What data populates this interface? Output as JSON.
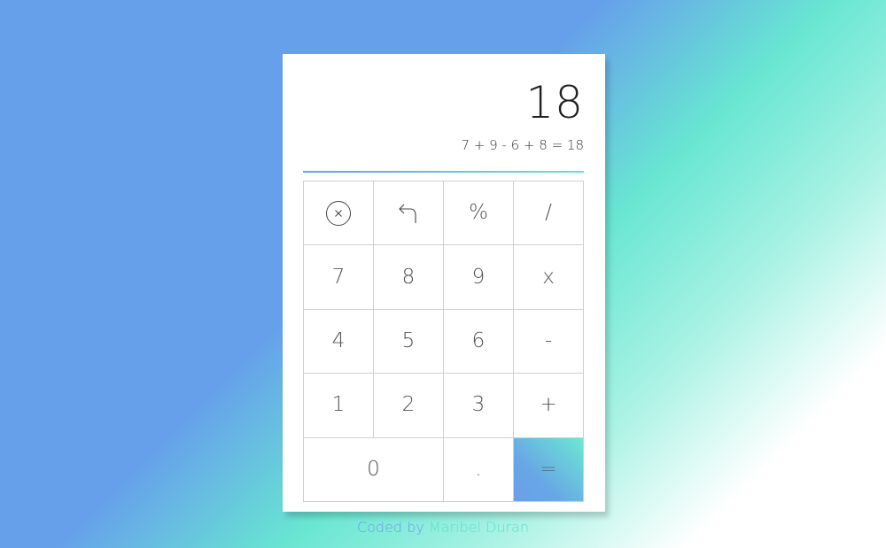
{
  "display": {
    "result": "18",
    "expression": "7 + 9 - 6 + 8 = 18"
  },
  "keys": {
    "clear_icon": "circle-x-icon",
    "undo_icon": "undo-arrow-icon",
    "percent": "%",
    "divide": "/",
    "seven": "7",
    "eight": "8",
    "nine": "9",
    "multiply": "x",
    "four": "4",
    "five": "5",
    "six": "6",
    "minus": "-",
    "one": "1",
    "two": "2",
    "three": "3",
    "plus": "+",
    "zero": "0",
    "decimal": ".",
    "equals": "="
  },
  "footer": {
    "label": "Coded by",
    "author": "Maribel Duran"
  },
  "colors": {
    "accent_blue": "#6a9fe8",
    "accent_teal": "#66e3d4"
  }
}
